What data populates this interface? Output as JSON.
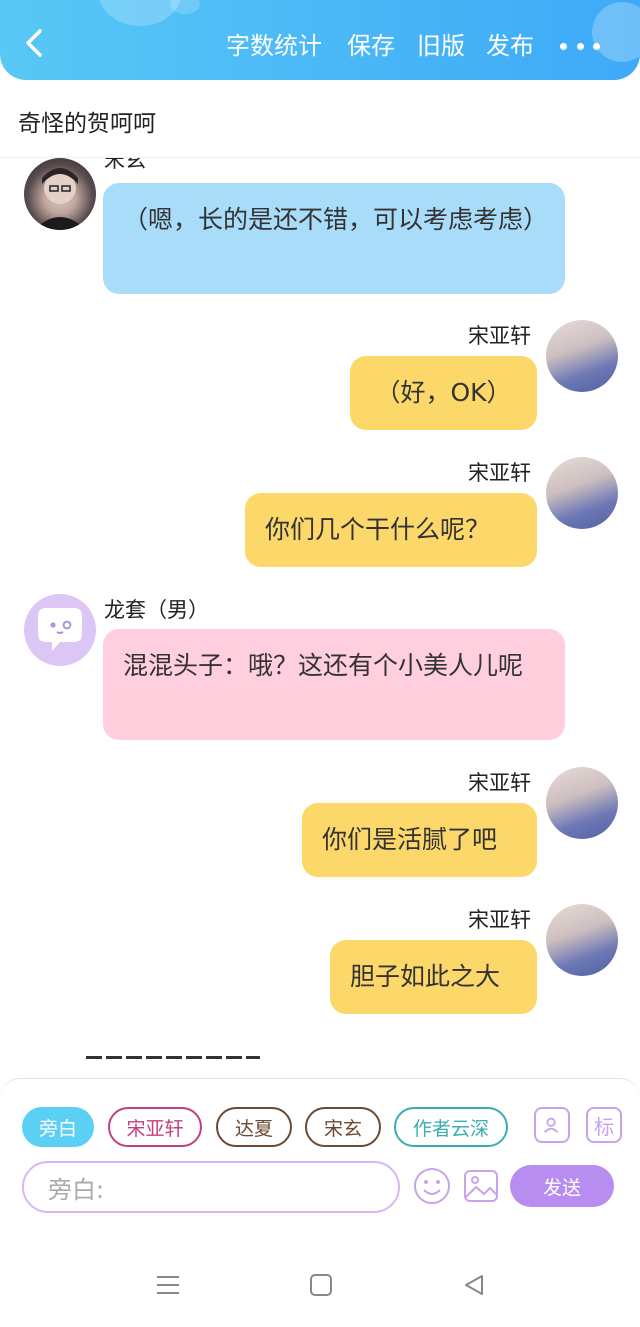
{
  "header": {
    "back_icon": "chevron-left-icon",
    "actions": [
      "字数统计",
      "保存",
      "旧版",
      "发布"
    ],
    "more_icon": "more-dots-icon",
    "colors": {
      "gradient_start": "#58c8f5",
      "gradient_end": "#3ea9f7"
    }
  },
  "title": "奇怪的贺呵呵",
  "messages": [
    {
      "sender": "宋玄",
      "side": "left",
      "color": "blue",
      "text": "（嗯，长的是还不错，可以考虑考虑）"
    },
    {
      "sender": "宋亚轩",
      "side": "right",
      "color": "yellow",
      "text": "（好，OK）"
    },
    {
      "sender": "宋亚轩",
      "side": "right",
      "color": "yellow",
      "text": "你们几个干什么呢？"
    },
    {
      "sender": "龙套（男）",
      "side": "left",
      "color": "pink",
      "text": "混混头子：哦？这还有个小美人儿呢"
    },
    {
      "sender": "宋亚轩",
      "side": "right",
      "color": "yellow",
      "text": "你们是活腻了吧"
    },
    {
      "sender": "宋亚轩",
      "side": "right",
      "color": "yellow",
      "text": "胆子如此之大"
    }
  ],
  "bottom": {
    "chips": [
      "旁白",
      "宋亚轩",
      "达夏",
      "宋玄",
      "作者云深"
    ],
    "active_chip": "旁白",
    "side_icons": [
      "character-card-icon",
      "标"
    ],
    "input_placeholder": "旁白:",
    "emoji_icon": "smiley-icon",
    "image_icon": "image-icon",
    "send_label": "发送"
  },
  "navbar": {
    "icons": [
      "menu-icon",
      "home-square-icon",
      "back-triangle-icon"
    ]
  }
}
